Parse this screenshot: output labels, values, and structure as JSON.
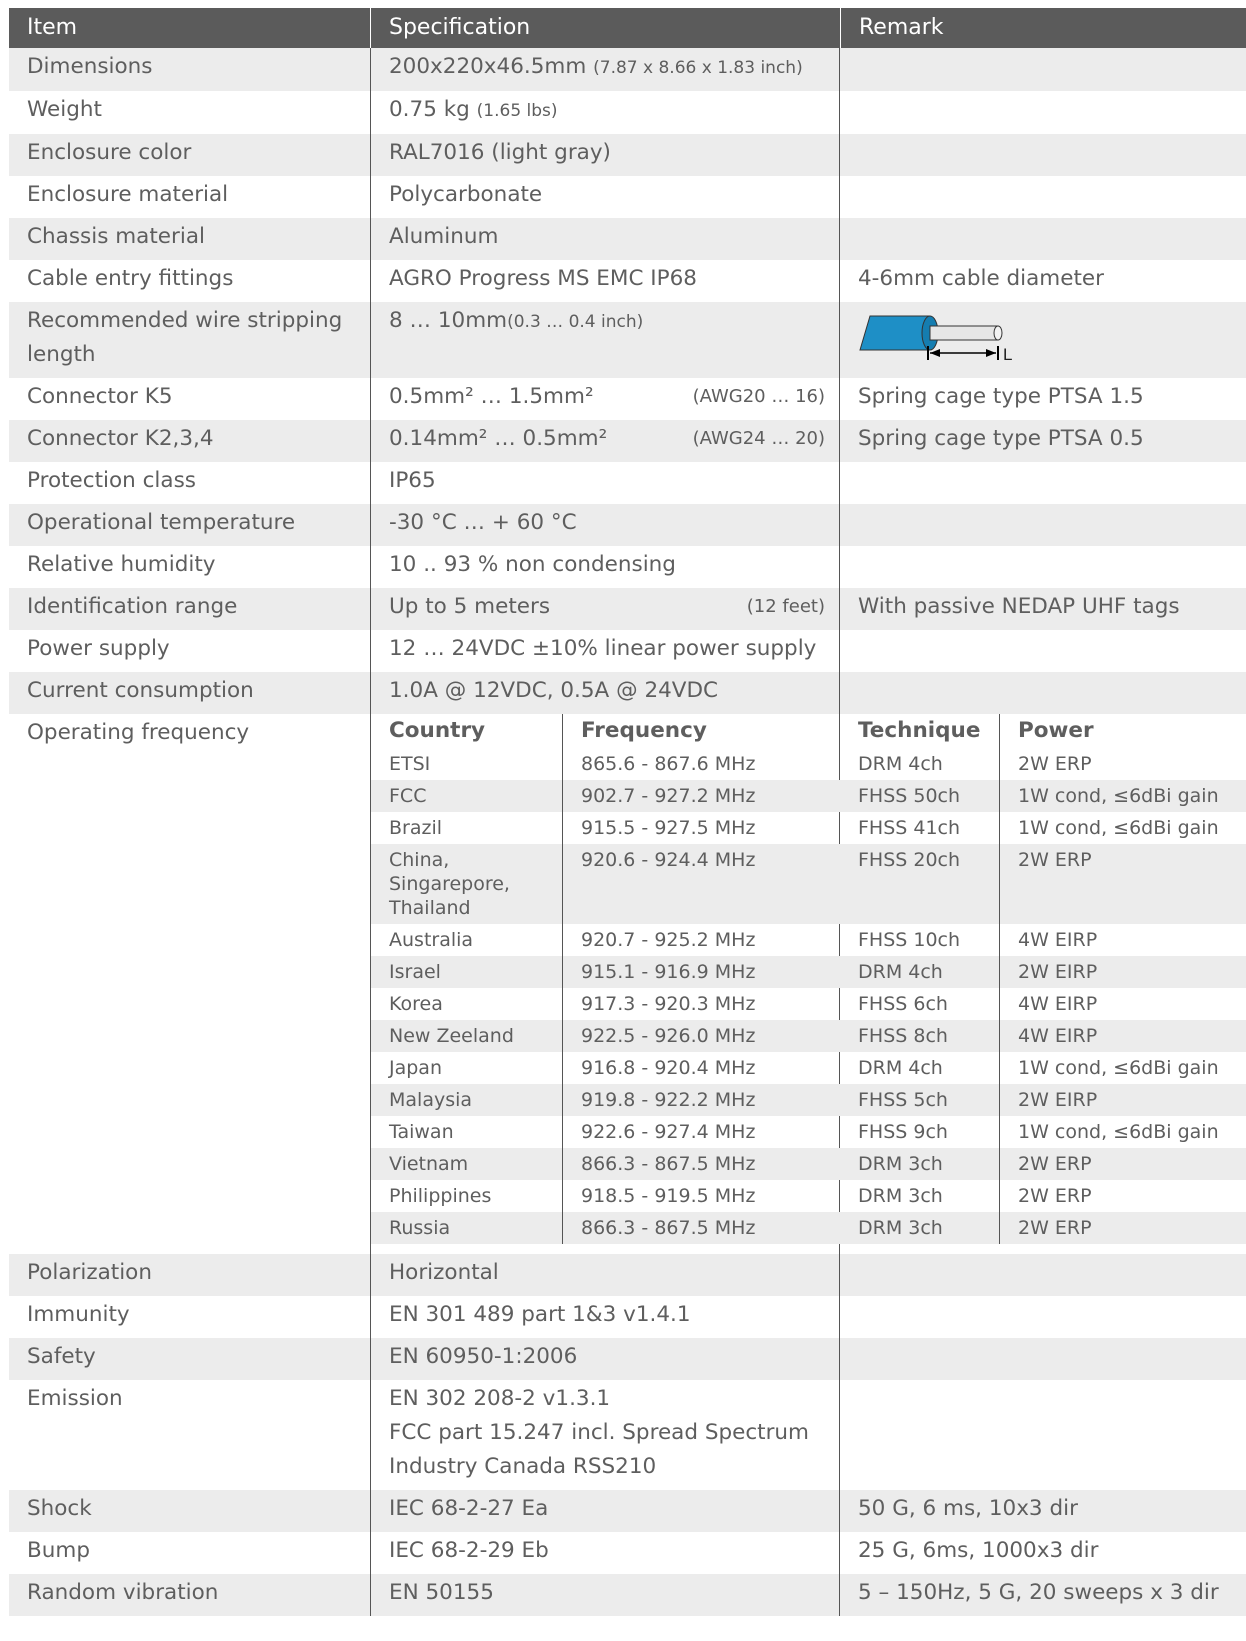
{
  "headers": {
    "item": "Item",
    "specification": "Specification",
    "remark": "Remark"
  },
  "rows_top": [
    {
      "item": "Dimensions",
      "spec_main": "200x220x46.5mm",
      "spec_small": "(7.87 x 8.66 x 1.83 inch)",
      "remark": ""
    },
    {
      "item": "Weight",
      "spec_main": "0.75 kg",
      "spec_small": "(1.65 lbs)",
      "remark": ""
    },
    {
      "item": "Enclosure color",
      "spec_main": "RAL7016 (light gray)",
      "spec_small": "",
      "remark": ""
    },
    {
      "item": "Enclosure material",
      "spec_main": "Polycarbonate",
      "spec_small": "",
      "remark": ""
    },
    {
      "item": "Chassis material",
      "spec_main": "Aluminum",
      "spec_small": "",
      "remark": ""
    },
    {
      "item": "Cable entry fittings",
      "spec_main": "AGRO Progress MS EMC IP68",
      "spec_small": "",
      "remark": "4-6mm cable diameter"
    }
  ],
  "wire_row": {
    "item": "Recommended wire stripping length",
    "spec_main": "8 … 10mm",
    "spec_small": "(0.3 … 0.4 inch)",
    "wire_label": "L",
    "wire_color": "#1e8fc6"
  },
  "rows_connectors": [
    {
      "item": "Connector K5",
      "spec_main": "0.5mm² … 1.5mm²",
      "spec_awg": "(AWG20 … 16)",
      "remark": "Spring cage type PTSA 1.5"
    },
    {
      "item": "Connector K2,3,4",
      "spec_main": "0.14mm² … 0.5mm²",
      "spec_awg": "(AWG24 … 20)",
      "remark": "Spring cage type PTSA 0.5"
    }
  ],
  "rows_mid": [
    {
      "item": "Protection class",
      "spec_main": "IP65",
      "spec_right": "",
      "remark": ""
    },
    {
      "item": "Operational temperature",
      "spec_main": "-30 °C … + 60 °C",
      "spec_right": "",
      "remark": ""
    },
    {
      "item": "Relative humidity",
      "spec_main": "10 .. 93 % non condensing",
      "spec_right": "",
      "remark": ""
    },
    {
      "item": "Identification range",
      "spec_main": "Up to 5 meters",
      "spec_right": "(12 feet)",
      "remark": "With passive NEDAP UHF tags"
    },
    {
      "item": "Power supply",
      "spec_main": "12 … 24VDC ±10% linear power supply",
      "spec_right": "",
      "remark": ""
    },
    {
      "item": "Current consumption",
      "spec_main": "1.0A @ 12VDC, 0.5A @ 24VDC",
      "spec_right": "",
      "remark": ""
    }
  ],
  "frequency": {
    "item": "Operating frequency",
    "headers": {
      "country": "Country",
      "frequency": "Frequency",
      "technique": "Technique",
      "power": "Power"
    },
    "rows": [
      {
        "country": [
          "ETSI"
        ],
        "frequency": "865.6 - 867.6 MHz",
        "technique": "DRM 4ch",
        "power": "2W ERP"
      },
      {
        "country": [
          "FCC"
        ],
        "frequency": "902.7 - 927.2 MHz",
        "technique": "FHSS 50ch",
        "power": "1W cond, ≤6dBi gain"
      },
      {
        "country": [
          "Brazil"
        ],
        "frequency": "915.5 - 927.5 MHz",
        "technique": "FHSS 41ch",
        "power": "1W cond, ≤6dBi gain"
      },
      {
        "country": [
          "China,",
          "Singarepore,",
          "Thailand"
        ],
        "frequency": "920.6 - 924.4 MHz",
        "technique": "FHSS 20ch",
        "power": "2W ERP"
      },
      {
        "country": [
          "Australia"
        ],
        "frequency": "920.7 - 925.2 MHz",
        "technique": "FHSS 10ch",
        "power": "4W EIRP"
      },
      {
        "country": [
          "Israel"
        ],
        "frequency": "915.1 - 916.9 MHz",
        "technique": "DRM 4ch",
        "power": "2W EIRP"
      },
      {
        "country": [
          "Korea"
        ],
        "frequency": "917.3 - 920.3 MHz",
        "technique": "FHSS 6ch",
        "power": "4W EIRP"
      },
      {
        "country": [
          "New Zeeland"
        ],
        "frequency": "922.5 - 926.0 MHz",
        "technique": "FHSS 8ch",
        "power": "4W EIRP"
      },
      {
        "country": [
          "Japan"
        ],
        "frequency": "916.8 - 920.4 MHz",
        "technique": "DRM  4ch",
        "power": "1W cond, ≤6dBi gain"
      },
      {
        "country": [
          "Malaysia"
        ],
        "frequency": "919.8 - 922.2 MHz",
        "technique": "FHSS 5ch",
        "power": "2W EIRP"
      },
      {
        "country": [
          "Taiwan"
        ],
        "frequency": "922.6 - 927.4 MHz",
        "technique": "FHSS 9ch",
        "power": "1W cond, ≤6dBi gain"
      },
      {
        "country": [
          "Vietnam"
        ],
        "frequency": "866.3 - 867.5 MHz",
        "technique": "DRM 3ch",
        "power": "2W ERP"
      },
      {
        "country": [
          "Philippines"
        ],
        "frequency": "918.5 - 919.5 MHz",
        "technique": "DRM 3ch",
        "power": "2W ERP"
      },
      {
        "country": [
          "Russia"
        ],
        "frequency": "866.3 - 867.5 MHz",
        "technique": "DRM 3ch",
        "power": "2W ERP"
      }
    ]
  },
  "rows_bottom": [
    {
      "item": "Polarization",
      "spec": [
        "Horizontal"
      ],
      "remark": ""
    },
    {
      "item": "Immunity",
      "spec": [
        "EN 301 489 part 1&3 v1.4.1"
      ],
      "remark": ""
    },
    {
      "item": "Safety",
      "spec": [
        "EN 60950-1:2006"
      ],
      "remark": ""
    },
    {
      "item": "Emission",
      "spec": [
        "EN 302 208-2 v1.3.1",
        "FCC part 15.247 incl. Spread Spectrum",
        "Industry Canada RSS210"
      ],
      "remark": ""
    },
    {
      "item": "Shock",
      "spec": [
        "IEC 68-2-27 Ea"
      ],
      "remark": "50 G, 6 ms, 10x3 dir"
    },
    {
      "item": "Bump",
      "spec": [
        "IEC 68-2-29 Eb"
      ],
      "remark": "25 G, 6ms, 1000x3 dir"
    },
    {
      "item": "Random vibration",
      "spec": [
        "EN 50155"
      ],
      "remark": "5 – 150Hz, 5 G, 20 sweeps x 3 dir"
    }
  ]
}
